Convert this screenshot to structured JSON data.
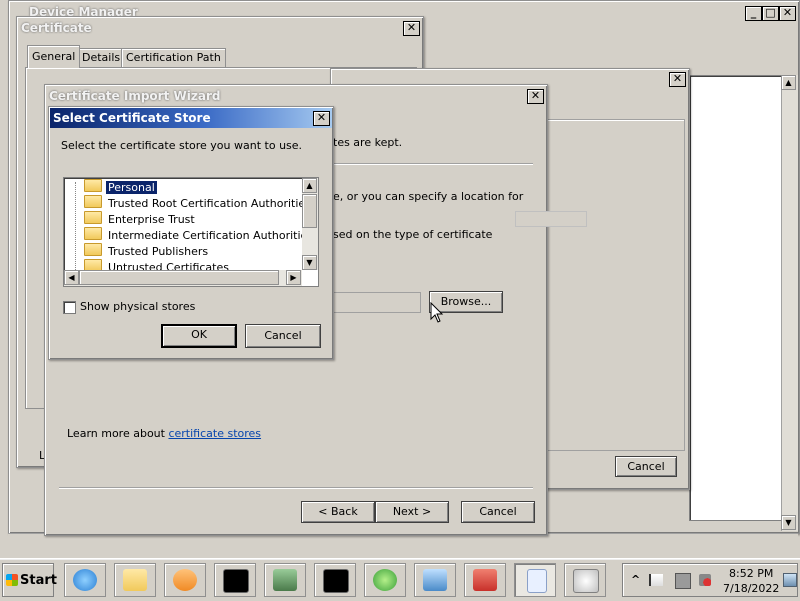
{
  "colors": {
    "desktop_bg": "#d4d0c8",
    "selection": "#0a246a",
    "link": "#0645ad",
    "active_title_start": "#0a246a"
  },
  "device_manager": {
    "title": "Device Manager",
    "minimize_icon": "minimize-icon",
    "maximize_icon": "maximize-icon",
    "close_icon": "close-icon",
    "glyph_min": "_",
    "glyph_max": "□",
    "glyph_close": "✕"
  },
  "certificate": {
    "title": "Certificate",
    "close_glyph": "✕",
    "tabs": [
      {
        "label": "General"
      },
      {
        "label": "Details"
      },
      {
        "label": "Certification Path"
      }
    ],
    "footer_partial": "Le"
  },
  "behind_dialog": {
    "close_glyph": "✕",
    "cancel_label": "Cancel"
  },
  "import_wizard": {
    "title": "Certificate Import Wizard",
    "close_glyph": "✕",
    "partial_line1": "tes are kept.",
    "partial_line2": "e, or you can specify a location for",
    "partial_line3": "sed on the type of certificate",
    "browse_label": "Browse...",
    "learn_more_prefix": "Learn more about ",
    "learn_more_link": "certificate stores",
    "back_label": "< Back",
    "next_label": "Next >",
    "cancel_label": "Cancel"
  },
  "select_store": {
    "title": "Select Certificate Store",
    "close_glyph": "✕",
    "instruction": "Select the certificate store you want to use.",
    "stores": [
      {
        "label": "Personal"
      },
      {
        "label": "Trusted Root Certification Authorities"
      },
      {
        "label": "Enterprise Trust"
      },
      {
        "label": "Intermediate Certification Authorities"
      },
      {
        "label": "Trusted Publishers"
      },
      {
        "label": "Untrusted Certificates"
      }
    ],
    "selected_index": 0,
    "show_physical_label": "Show physical stores",
    "show_physical_checked": false,
    "ok_label": "OK",
    "cancel_label": "Cancel",
    "scroll_up_glyph": "▲",
    "scroll_down_glyph": "▼",
    "scroll_left_glyph": "◀",
    "scroll_right_glyph": "▶"
  },
  "taskbar": {
    "start_label": "Start",
    "time": "8:52 PM",
    "date": "7/18/2022",
    "tray_expand_glyph": "^",
    "apps": [
      {
        "icon": "internet-explorer-icon",
        "color": "#2a7fd4"
      },
      {
        "icon": "folder-icon",
        "color": "#f1c95b"
      },
      {
        "icon": "media-player-icon",
        "color": "#f08a24"
      },
      {
        "icon": "command-prompt-icon",
        "color": "#000000"
      },
      {
        "icon": "network-monitor-icon",
        "color": "#4a7a4a"
      },
      {
        "icon": "command-prompt-icon",
        "color": "#000000"
      },
      {
        "icon": "windows-icon",
        "color": "#3aa03a"
      },
      {
        "icon": "control-panel-icon",
        "color": "#4a8ac8"
      },
      {
        "icon": "toolbox-icon",
        "color": "#c8302a"
      },
      {
        "icon": "document-icon",
        "color": "#e8f0ff"
      },
      {
        "icon": "disk-icon",
        "color": "#c0c0c0"
      }
    ]
  }
}
